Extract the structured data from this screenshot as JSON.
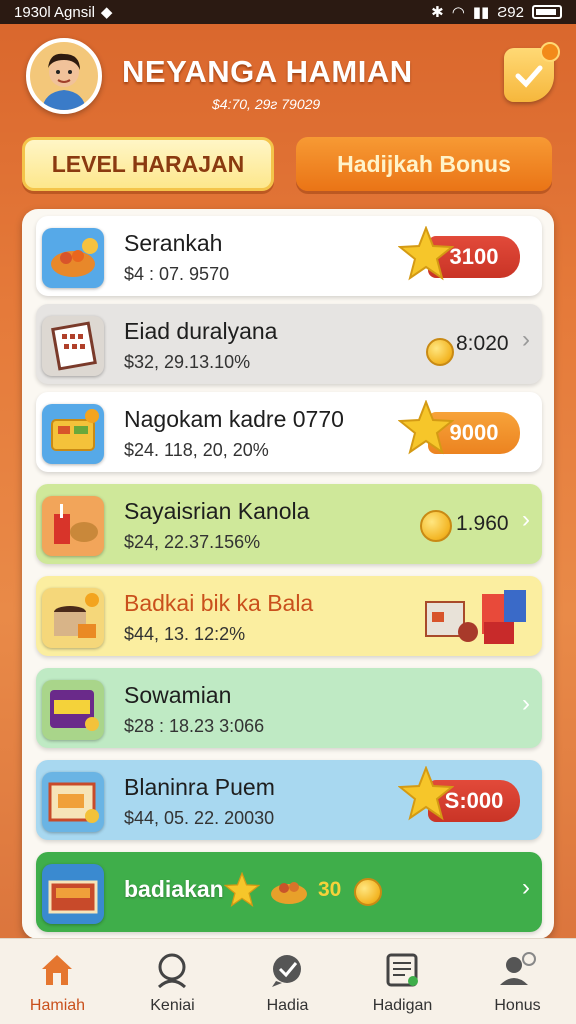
{
  "status_bar": {
    "left_text": "1930l Agnsil",
    "right_text": "Ƨ92"
  },
  "header": {
    "username": "NEYANGA HAMIAN",
    "balance": "$4:70, 29ƨ 79029"
  },
  "tabs": [
    {
      "label": "LEVEL HARAJAN",
      "active": true
    },
    {
      "label": "Hadijkah Bonus",
      "active": false
    }
  ],
  "list": [
    {
      "title": "Serankah",
      "subtitle": "$4 : 07. 9570",
      "value": "3100",
      "value_style": "red-ribbon",
      "thumb_icon": "food-bowl-icon",
      "bg": "#ffffff"
    },
    {
      "title": "Eiad duralyana",
      "subtitle": "$32, 29.13.10%",
      "value": "8:020",
      "value_style": "coin",
      "thumb_icon": "calendar-board-icon",
      "bg": "#e6e4e2"
    },
    {
      "title": "Nagokam kadre 0770",
      "subtitle": "$24. 118, 20, 20%",
      "value": "9000",
      "value_style": "orange-ribbon",
      "thumb_icon": "lunchbox-icon",
      "bg": "#ffffff"
    },
    {
      "title": "Sayaisrian Kanola",
      "subtitle": "$24, 22.37.156%",
      "value": "1.960",
      "value_style": "coin",
      "thumb_icon": "drink-food-icon",
      "bg": "#cfe89a"
    },
    {
      "title": "Badkai bik ka Bala",
      "subtitle": "$44, 13. 12:2%",
      "value": "",
      "value_style": "gifts",
      "thumb_icon": "pot-icon",
      "bg": "#fbeea0"
    },
    {
      "title": "Sowamian",
      "subtitle": "$28 : 18.23 3:066",
      "value": "",
      "value_style": "chevron",
      "thumb_icon": "snack-bag-icon",
      "bg": "#bfeac4"
    },
    {
      "title": "Blaninra Puem",
      "subtitle": "$44, 05. 22. 20030",
      "value": "S:000",
      "value_style": "red-ribbon",
      "thumb_icon": "snack-pack-icon",
      "bg": "#a8d8f0"
    },
    {
      "title": "badiakan",
      "subtitle": "",
      "value": "30",
      "value_style": "green-bar",
      "thumb_icon": "food-box-icon",
      "bg": "#3fae4a"
    }
  ],
  "bottom_nav": [
    {
      "label": "Hamiah",
      "icon": "home-icon",
      "active": true
    },
    {
      "label": "Keniai",
      "icon": "profile-icon",
      "active": false
    },
    {
      "label": "Hadia",
      "icon": "chat-icon",
      "active": false
    },
    {
      "label": "Hadigan",
      "icon": "document-icon",
      "active": false
    },
    {
      "label": "Honus",
      "icon": "user-settings-icon",
      "active": false
    }
  ],
  "colors": {
    "accent": "#e5762f",
    "ribbon_red": "#d43d2f",
    "ribbon_orange": "#f0902a",
    "green": "#3fae4a"
  }
}
